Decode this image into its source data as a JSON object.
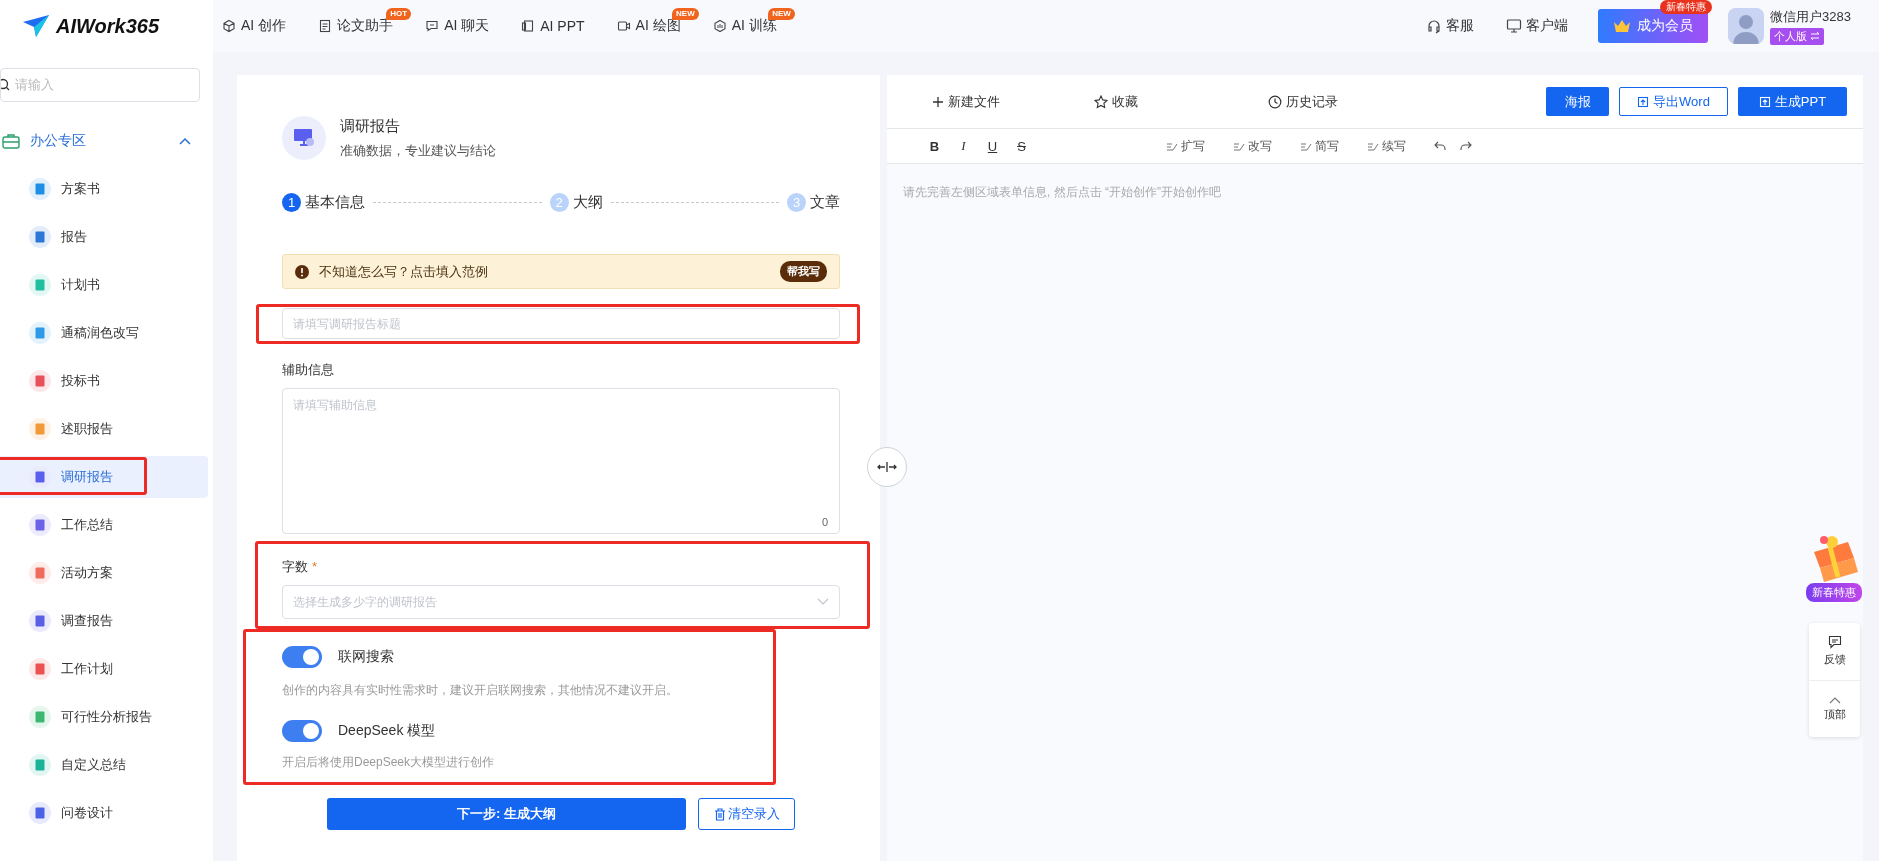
{
  "header": {
    "logo": "AIWork365",
    "nav": [
      {
        "label": "AI 创作"
      },
      {
        "label": "论文助手",
        "badge": "HOT"
      },
      {
        "label": "AI 聊天"
      },
      {
        "label": "AI PPT"
      },
      {
        "label": "AI 绘图",
        "badge": "NEW"
      },
      {
        "label": "AI 训练",
        "badge": "NEW"
      }
    ],
    "service": "客服",
    "client": "客户端",
    "vip": {
      "label": "成为会员",
      "badge": "新春特惠"
    },
    "user": {
      "name": "微信用户3283",
      "plan": "个人版"
    }
  },
  "sidebar": {
    "search_placeholder": "请输入",
    "group": {
      "label": "办公专区",
      "expanded": true,
      "items": [
        {
          "label": "方案书",
          "selected": false,
          "highlighted": false,
          "color": "#1d8fe6"
        },
        {
          "label": "报告",
          "selected": false,
          "highlighted": false,
          "color": "#2b78d8"
        },
        {
          "label": "计划书",
          "selected": false,
          "highlighted": false,
          "color": "#1fbfa0"
        },
        {
          "label": "通稿润色改写",
          "selected": false,
          "highlighted": false,
          "color": "#2f9be8"
        },
        {
          "label": "投标书",
          "selected": false,
          "highlighted": false,
          "color": "#e8505b"
        },
        {
          "label": "述职报告",
          "selected": false,
          "highlighted": false,
          "color": "#f29a38"
        },
        {
          "label": "调研报告",
          "selected": true,
          "highlighted": true,
          "color": "#5b5ff0"
        },
        {
          "label": "工作总结",
          "selected": false,
          "highlighted": false,
          "color": "#6a63e8"
        },
        {
          "label": "活动方案",
          "selected": false,
          "highlighted": false,
          "color": "#ef6b5b"
        },
        {
          "label": "调查报告",
          "selected": false,
          "highlighted": false,
          "color": "#5a5fe6"
        },
        {
          "label": "工作计划",
          "selected": false,
          "highlighted": false,
          "color": "#ea5350"
        },
        {
          "label": "可行性分析报告",
          "selected": false,
          "highlighted": false,
          "color": "#3db873"
        },
        {
          "label": "自定义总结",
          "selected": false,
          "highlighted": false,
          "color": "#1ab39a"
        },
        {
          "label": "问卷设计",
          "selected": false,
          "highlighted": false,
          "color": "#4d60e8"
        }
      ]
    }
  },
  "form": {
    "title": "调研报告",
    "subtitle": "准确数据，专业建议与结论",
    "steps": [
      {
        "number": "1",
        "label": "基本信息",
        "active": true
      },
      {
        "number": "2",
        "label": "大纲",
        "active": false
      },
      {
        "number": "3",
        "label": "文章",
        "active": false
      }
    ],
    "tip": {
      "text": "不知道怎么写？点击填入范例",
      "button": "帮我写"
    },
    "title_field": {
      "placeholder": "请填写调研报告标题",
      "highlighted": true
    },
    "aux": {
      "label": "辅助信息",
      "placeholder": "请填写辅助信息",
      "count": "0"
    },
    "word_count": {
      "label": "字数",
      "required_mark": "*",
      "placeholder": "选择生成多少字的调研报告",
      "highlighted": true
    },
    "options": {
      "highlighted": true,
      "toggles": [
        {
          "label": "联网搜索",
          "on": true,
          "description": "创作的内容具有实时性需求时，建议开启联网搜索，其他情况不建议开启。"
        },
        {
          "label": "DeepSeek 模型",
          "on": true,
          "description": "开启后将使用DeepSeek大模型进行创作"
        }
      ]
    },
    "next_button": "下一步: 生成大纲",
    "clear_button": "清空录入"
  },
  "editor": {
    "new_file": "新建文件",
    "favorite": "收藏",
    "history": "历史记录",
    "actions": [
      {
        "label": "海报",
        "kind": "primary"
      },
      {
        "label": "导出Word",
        "kind": "outline"
      },
      {
        "label": "生成PPT",
        "kind": "primary"
      }
    ],
    "format": [
      {
        "label": "B",
        "kind": "bold"
      },
      {
        "label": "I",
        "kind": "italic"
      },
      {
        "label": "U",
        "kind": "underline"
      },
      {
        "label": "S",
        "kind": "strike"
      }
    ],
    "ai_tools": [
      "扩写",
      "改写",
      "简写",
      "续写"
    ],
    "placeholder": "请先完善左侧区域表单信息, 然后点击 “开始创作”开始创作吧"
  },
  "promo": {
    "label": "新春特惠"
  },
  "float_bar": {
    "feedback": "反馈",
    "top": "顶部"
  }
}
